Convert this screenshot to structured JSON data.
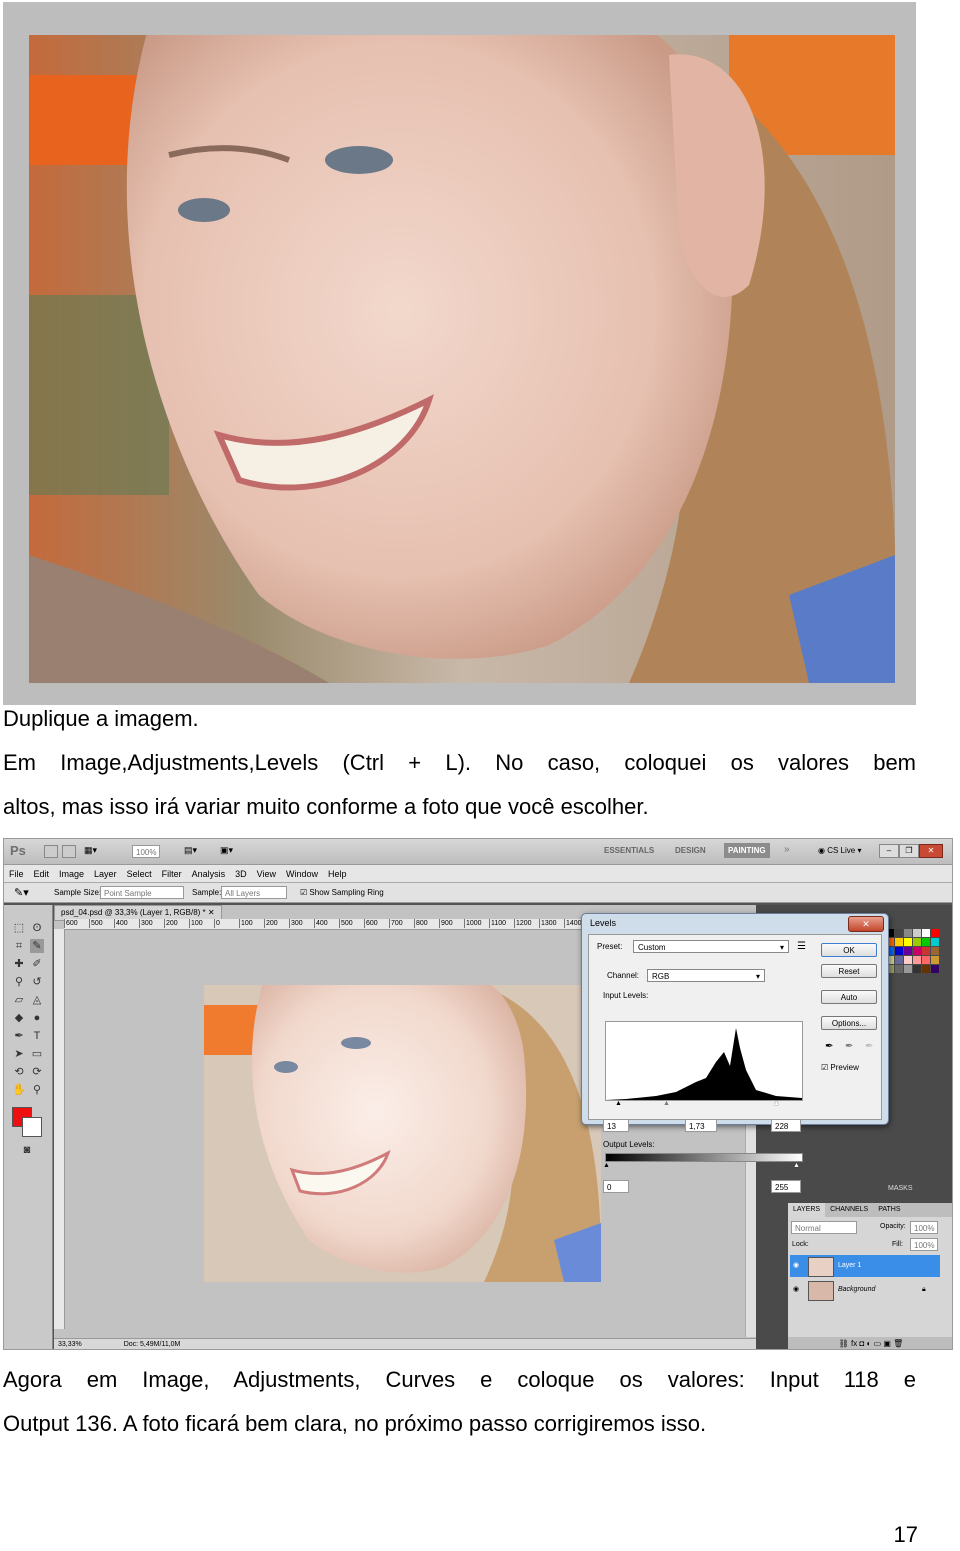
{
  "paragraphs": {
    "p1": "Duplique a imagem.",
    "p2_line1": "Em Image,Adjustments,Levels (Ctrl + L). No caso, coloquei os valores bem",
    "p2_line2": "altos, mas isso irá variar muito conforme a foto que você escolher.",
    "p3_line1": "Agora em Image, Adjustments, Curves e coloque os valores: Input 118 e",
    "p3_line2": "Output 136. A foto ficará bem clara, no próximo passo corrigiremos isso."
  },
  "page_number": "17",
  "photoshop": {
    "app_logo": "Ps",
    "zoom": "100%",
    "workspaces": [
      "ESSENTIALS",
      "DESIGN",
      "PAINTING"
    ],
    "cs_live": "CS Live",
    "menu": [
      "File",
      "Edit",
      "Image",
      "Layer",
      "Select",
      "Filter",
      "Analysis",
      "3D",
      "View",
      "Window",
      "Help"
    ],
    "options": {
      "sample_size_label": "Sample Size:",
      "sample_size_value": "Point Sample",
      "sample_label": "Sample:",
      "sample_value": "All Layers",
      "show_ring": "Show Sampling Ring"
    },
    "doc_tab": "psd_04.psd @ 33,3% (Layer 1, RGB/8) *",
    "ruler_ticks": [
      "600",
      "500",
      "400",
      "300",
      "200",
      "100",
      "0",
      "100",
      "200",
      "300",
      "400",
      "500",
      "600",
      "700",
      "800",
      "900",
      "1000",
      "1100",
      "1200",
      "1300",
      "1400"
    ],
    "status_zoom": "33,33%",
    "status_doc": "Doc: 5,49M/11,0M",
    "levels": {
      "title": "Levels",
      "preset_label": "Preset:",
      "preset_value": "Custom",
      "channel_label": "Channel:",
      "channel_value": "RGB",
      "input_levels_label": "Input Levels:",
      "input_black": "13",
      "input_gamma": "1,73",
      "input_white": "228",
      "output_levels_label": "Output Levels:",
      "output_black": "0",
      "output_white": "255",
      "ok": "OK",
      "reset": "Reset",
      "auto": "Auto",
      "options": "Options...",
      "preview": "Preview",
      "preview_checked": true
    },
    "panels": {
      "masks_tab": "MASKS",
      "layer_tabs": [
        "LAYERS",
        "CHANNELS",
        "PATHS"
      ],
      "blend_mode": "Normal",
      "opacity_label": "Opacity:",
      "opacity_value": "100%",
      "lock_label": "Lock:",
      "fill_label": "Fill:",
      "fill_value": "100%",
      "layers": [
        "Layer 1",
        "Background"
      ]
    }
  }
}
